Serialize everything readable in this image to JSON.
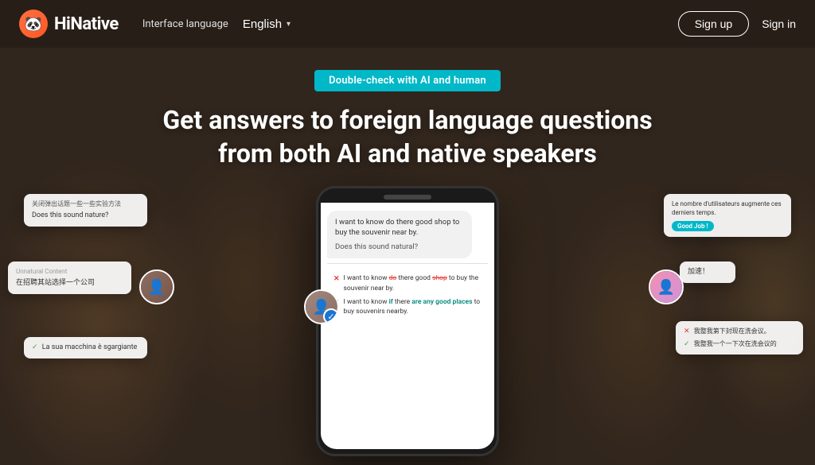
{
  "header": {
    "logo_text": "HiNative",
    "interface_label": "Interface language",
    "language_selected": "English",
    "signup_label": "Sign up",
    "signin_label": "Sign in"
  },
  "hero": {
    "badge_text": "Double-check with AI and human",
    "title_line1": "Get answers to foreign language questions",
    "title_line2": "from both AI and native speakers"
  },
  "phone": {
    "bubble_text1": "I want to know do there good shop to buy the souvenir near by.",
    "bubble_text2": "Does this sound natural?",
    "correction_wrong": "I want to know do there good shop to buy the souvenir near by.",
    "correction_right": "I want to know if there are any good places to buy souvenirs nearby."
  },
  "float_cards": {
    "card1": {
      "text1": "关闭弹出话题一些一些实验方法",
      "text2": "Does this sound nature?"
    },
    "card2": {
      "label": "Unnatural Content",
      "main": "在招聘其站选择一个公司"
    },
    "card3": {
      "check": "La sua macchina è sgargiante"
    },
    "card4": {
      "line1": "Le nombre d'utilisateurs",
      "line2": "augmente ces derniers temps."
    },
    "card4_badge": "Good Job !",
    "card5": {
      "line1": "加速！"
    },
    "card6": {
      "line1": "我整我第下封现在洗会议。",
      "line2": "我整我一个一下次在洗会议的"
    }
  },
  "icons": {
    "logo_emoji": "🐼",
    "chevron_down": "▾",
    "checkmark": "✓",
    "x_mark": "✕"
  }
}
